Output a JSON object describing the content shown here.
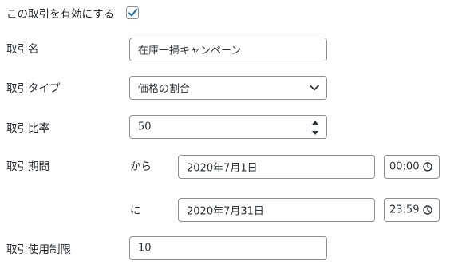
{
  "enable": {
    "label": "この取引を有効にする",
    "checked": true
  },
  "deal_name": {
    "label": "取引名",
    "value": "在庫一掃キャンペーン"
  },
  "deal_type": {
    "label": "取引タイプ",
    "selected": "価格の割合"
  },
  "deal_rate": {
    "label": "取引比率",
    "value": "50"
  },
  "deal_period": {
    "label": "取引期間",
    "from_label": "から",
    "from_date": "2020年7月1日",
    "from_time": "00:00",
    "to_label": "に",
    "to_date": "2020年7月31日",
    "to_time": "23:59"
  },
  "usage_limit": {
    "label": "取引使用制限",
    "value": "10"
  },
  "colors": {
    "border": "#8c8f94",
    "text": "#2c3338",
    "accent": "#2271b1"
  }
}
